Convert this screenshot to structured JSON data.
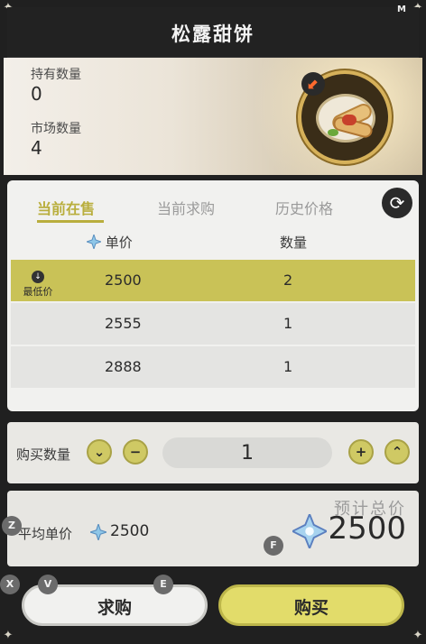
{
  "title": "松露甜饼",
  "owned": {
    "label": "持有数量",
    "value": "0"
  },
  "market": {
    "label": "市场数量",
    "value": "4"
  },
  "tabs": [
    {
      "label": "当前在售",
      "active": true
    },
    {
      "label": "当前求购",
      "active": false
    },
    {
      "label": "历史价格",
      "active": false
    }
  ],
  "table": {
    "headers": {
      "price": "单价",
      "quantity": "数量"
    },
    "lowest_label": "最低价",
    "rows": [
      {
        "price": "2500",
        "quantity": "2",
        "highlighted": true
      },
      {
        "price": "2555",
        "quantity": "1",
        "highlighted": false
      },
      {
        "price": "2888",
        "quantity": "1",
        "highlighted": false
      }
    ]
  },
  "purchase": {
    "label": "购买数量",
    "quantity": "1"
  },
  "summary": {
    "avg_label": "平均单价",
    "avg_value": "2500",
    "estimate_label": "预计总价",
    "total_value": "2500"
  },
  "buttons": {
    "request": "求购",
    "buy": "购买"
  },
  "hotkeys": {
    "top_right": "M",
    "avg": "Z",
    "total": "F",
    "x": "X",
    "v": "V",
    "e": "E"
  },
  "colors": {
    "accent": "#c9c257",
    "tab_active": "#b9ae3d"
  }
}
